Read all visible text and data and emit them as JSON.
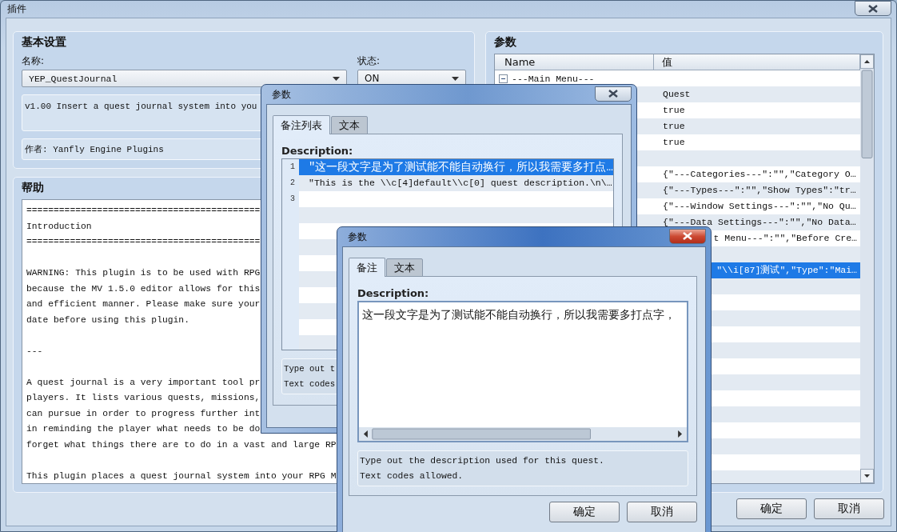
{
  "main_window": {
    "title": "插件",
    "basic_settings": {
      "title": "基本设置",
      "name_label": "名称:",
      "name_value": "YEP_QuestJournal",
      "status_label": "状态:",
      "status_value": "ON",
      "description": "v1.00 Insert a quest journal system into you",
      "author": "作者: Yanfly Engine Plugins"
    },
    "help": {
      "title": "帮助",
      "paragraphs": [
        [
          "===========================================",
          "Introduction",
          "==========================================="
        ],
        [
          "WARNING: This plugin is to be used with RPG",
          "because the MV 1.5.0 editor allows for this",
          "and efficient manner. Please make sure your",
          "date before using this plugin."
        ],
        [
          "---"
        ],
        [
          "A quest journal is a very important tool pr",
          "players. It lists various quests, missions,",
          "can pursue in order to progress further int",
          "in reminding the player what needs to be do",
          "forget what things there are to do in a vast and large RP"
        ],
        [
          "This plugin places a quest journal system into your RPG M"
        ]
      ]
    },
    "parameters": {
      "title": "参数",
      "columns": [
        "Name",
        "值"
      ],
      "rows": [
        {
          "name": "---Main Menu---",
          "expanded": true,
          "selected": false
        },
        {
          "value": "Quest",
          "selected": false
        },
        {
          "value": "true",
          "selected": false
        },
        {
          "value": "true",
          "selected": false
        },
        {
          "value": "true",
          "selected": false
        },
        {
          "selected": false
        },
        {
          "value": "{\"---Categories---\":\"\",\"Category O…",
          "selected": false
        },
        {
          "value": "{\"---Types---\":\"\",\"Show Types\":\"tr…",
          "selected": false
        },
        {
          "value": "{\"---Window Settings---\":\"\",\"No Qu…",
          "selected": false
        },
        {
          "value": "{\"---Data Settings---\":\"\",\"No Data…",
          "selected": false
        },
        {
          "value": "t Menu---\":\"\",\"Before Cre…",
          "cut_left": true,
          "selected": false
        },
        {
          "selected": false
        },
        {
          "value": "\"\\\\i[87]测试\",\"Type\":\"Mai…",
          "cut_left": true,
          "selected": true
        }
      ]
    },
    "buttons": [
      "确定",
      "取消"
    ]
  },
  "dialogs": [
    {
      "kind": "list",
      "title": "参数",
      "active": false,
      "tabs": [
        {
          "label": "备注列表",
          "selected": true
        },
        {
          "label": "文本",
          "selected": false
        }
      ],
      "field_label": "Description:",
      "rows": [
        {
          "number": "1",
          "text": "\"这一段文字是为了测试能不能自动换行，所以我需要多打点…",
          "selected": true
        },
        {
          "number": "2",
          "text": "\"This is the \\\\c[4]default\\\\c[0] quest description.\\n\\…",
          "selected": false
        },
        {
          "number": "3",
          "selected": false
        }
      ],
      "hint": [
        "Type out t",
        "Text codes"
      ]
    },
    {
      "kind": "text",
      "title": "参数",
      "active": true,
      "tabs": [
        {
          "label": "备注",
          "selected": true
        },
        {
          "label": "文本",
          "selected": false
        }
      ],
      "field_label": "Description:",
      "value": "这一段文字是为了测试能不能自动换行，所以我需要多打点字，",
      "hint": [
        "Type out the description used for this quest.",
        "Text codes allowed."
      ],
      "buttons": [
        "确定",
        "取消"
      ]
    }
  ]
}
